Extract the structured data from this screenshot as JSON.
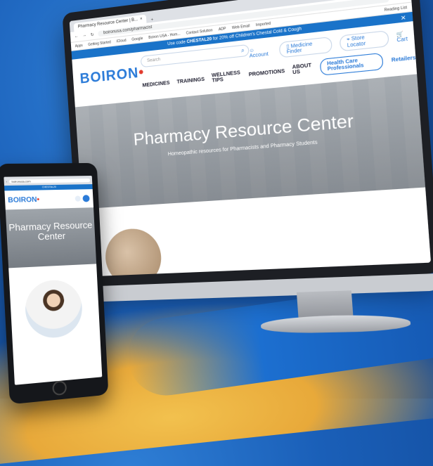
{
  "browser": {
    "tab_title": "Pharmacy Resource Center | B...",
    "tab_close": "×",
    "url": "boironusa.com/pharmacist",
    "bookmarks": [
      "Apps",
      "Getting Started",
      "iCloud",
      "Google",
      "Boiron USA - Hom...",
      "Contact Solution",
      "ADP",
      "Web Email",
      "Imported"
    ],
    "reading_list": "Reading List"
  },
  "promo": {
    "prefix": "Use code",
    "code": "CHESTAL20",
    "suffix": "for 20% off Children's Chestal Cold & Cough"
  },
  "site": {
    "logo_text": "BOIRON",
    "search_placeholder": "Search",
    "account": "Account",
    "medicine_finder": "Medicine Finder",
    "store_locator": "Store Locator",
    "cart": "Cart",
    "nav": [
      "MEDICINES",
      "TRAININGS",
      "WELLNESS TIPS",
      "PROMOTIONS",
      "ABOUT US"
    ],
    "hcp_button": "Health Care Professionals",
    "retailers": "Retailers"
  },
  "hero": {
    "title": "Pharmacy Resource Center",
    "subtitle": "Homeopathic resources for Pharmacists and Pharmacy Students"
  },
  "tablet": {
    "url": "boironusa.com",
    "logo_text": "BOIRON",
    "hero_title_line1": "Pharmacy Resource",
    "hero_title_line2": "Center"
  }
}
